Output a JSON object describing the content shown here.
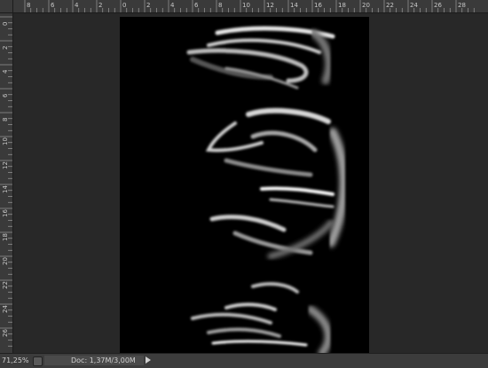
{
  "ruler": {
    "top_labels": [
      "8",
      "6",
      "4",
      "2",
      "0",
      "2",
      "4",
      "6",
      "8",
      "10",
      "12",
      "14",
      "16",
      "18",
      "20",
      "22",
      "24",
      "26",
      "28"
    ],
    "left_labels": [
      "0",
      "2",
      "4",
      "6",
      "8",
      "10",
      "12",
      "14",
      "16",
      "18",
      "20",
      "22",
      "24",
      "26"
    ]
  },
  "status": {
    "zoom": "71,25%",
    "doc_info": "Doc: 1,37M/3,00M"
  },
  "icons": {
    "status_icon": "document-status-icon",
    "menu_arrow": "play-arrow-icon"
  }
}
